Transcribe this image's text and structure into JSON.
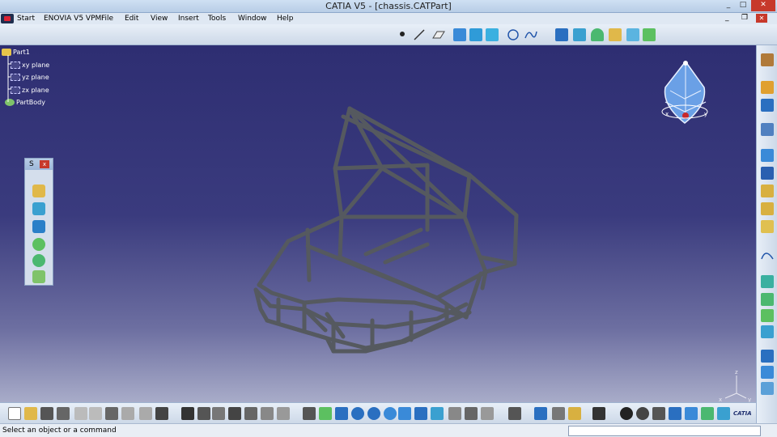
{
  "window": {
    "title": "CATIA V5 - [chassis.CATPart]",
    "minimize": "_",
    "maximize": "□",
    "close": "✕"
  },
  "menu": [
    {
      "label": "Start"
    },
    {
      "label": "ENOVIA V5 VPM"
    },
    {
      "label": "File"
    },
    {
      "label": "Edit"
    },
    {
      "label": "View"
    },
    {
      "label": "Insert"
    },
    {
      "label": "Tools"
    },
    {
      "label": "Window"
    },
    {
      "label": "Help"
    }
  ],
  "spec_tree": {
    "root": "Part1",
    "items": [
      "xy plane",
      "yz plane",
      "zx plane",
      "PartBody"
    ]
  },
  "floating_toolbar": {
    "title": "S",
    "close": "x"
  },
  "compass": {
    "x_label": "x",
    "y_label": "y"
  },
  "axis": {
    "x": "x",
    "y": "y",
    "z": "z"
  },
  "brand": {
    "name": "CATIA"
  },
  "status": {
    "message": "Select an object or a command",
    "command_input": ""
  },
  "colors": {
    "viewport_top": "#2e2e72",
    "viewport_bottom": "#b9bdd4",
    "frame_tube": "#4a4f55",
    "toolbar": "#dbe5f1"
  },
  "toolbar_icons": {
    "top": [
      "point-icon",
      "line-icon",
      "plane-icon",
      "extrude-icon",
      "sweep-icon",
      "fill-icon",
      "circle-icon",
      "spline-icon",
      "join-icon",
      "split-icon",
      "trim-icon",
      "shape-fillet-icon",
      "translate-icon"
    ],
    "right": [
      "sketcher-icon",
      "select-icon",
      "constraint-icon",
      "measure-icon",
      "axis-system-icon",
      "pattern-icon",
      "boolean-icon",
      "update-icon",
      "analysis-icon",
      "curve-icon",
      "surface-icon",
      "offset-icon",
      "blend-icon",
      "connect-icon",
      "apply-material-icon",
      "knowledge-icon"
    ],
    "bottom": [
      "new-icon",
      "open-icon",
      "save-icon",
      "print-icon",
      "cut-icon",
      "copy-icon",
      "paste-icon",
      "undo-icon",
      "redo-icon",
      "whats-this-icon",
      "formula-icon",
      "comment-icon",
      "knowledge-icon",
      "table-icon",
      "pattern-icon",
      "parameter-icon",
      "fly-mode-icon",
      "fit-all-icon",
      "pan-icon",
      "rotate-icon",
      "zoom-in-icon",
      "zoom-out-icon",
      "normal-view-icon",
      "iso-view-icon",
      "shading-icon",
      "hide-show-icon",
      "swap-visible-icon",
      "measure-icon",
      "material-icon",
      "scan-icon",
      "catalog-icon",
      "wireframe-icon",
      "grid-icon",
      "3d-compass-icon"
    ]
  }
}
